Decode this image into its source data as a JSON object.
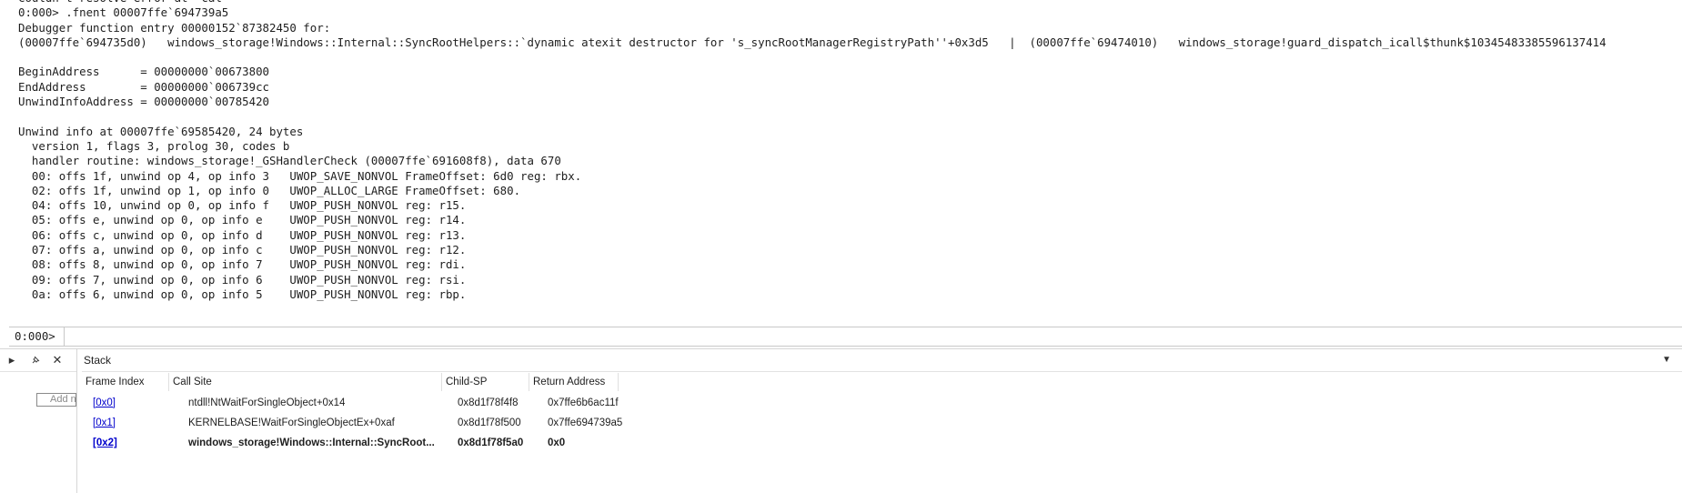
{
  "console": {
    "lines": [
      "Couldn't resolve error at 'cal",
      "0:000> .fnent 00007ffe`694739a5",
      "Debugger function entry 00000152`87382450 for:",
      "(00007ffe`694735d0)   windows_storage!Windows::Internal::SyncRootHelpers::`dynamic atexit destructor for 's_syncRootManagerRegistryPath''+0x3d5   |  (00007ffe`69474010)   windows_storage!guard_dispatch_icall$thunk$10345483385596137414",
      "",
      "BeginAddress      = 00000000`00673800",
      "EndAddress        = 00000000`006739cc",
      "UnwindInfoAddress = 00000000`00785420",
      "",
      "Unwind info at 00007ffe`69585420, 24 bytes",
      "  version 1, flags 3, prolog 30, codes b",
      "  handler routine: windows_storage!_GSHandlerCheck (00007ffe`691608f8), data 670",
      "  00: offs 1f, unwind op 4, op info 3   UWOP_SAVE_NONVOL FrameOffset: 6d0 reg: rbx.",
      "  02: offs 1f, unwind op 1, op info 0   UWOP_ALLOC_LARGE FrameOffset: 680.",
      "  04: offs 10, unwind op 0, op info f   UWOP_PUSH_NONVOL reg: r15.",
      "  05: offs e, unwind op 0, op info e    UWOP_PUSH_NONVOL reg: r14.",
      "  06: offs c, unwind op 0, op info d    UWOP_PUSH_NONVOL reg: r13.",
      "  07: offs a, unwind op 0, op info c    UWOP_PUSH_NONVOL reg: r12.",
      "  08: offs 8, unwind op 0, op info 7    UWOP_PUSH_NONVOL reg: rdi.",
      "  09: offs 7, unwind op 0, op info 6    UWOP_PUSH_NONVOL reg: rsi.",
      "  0a: offs 6, unwind op 0, op info 5    UWOP_PUSH_NONVOL reg: rbp."
    ]
  },
  "command": {
    "prompt": "0:000>",
    "value": ""
  },
  "leftpane": {
    "add_placeholder": "Add n",
    "pin_icon": "pin-icon",
    "close_icon": "close-icon"
  },
  "stack": {
    "title": "Stack",
    "dropdown_icon": "chevron-down-icon",
    "columns": {
      "frame_index": "Frame Index",
      "call_site": "Call Site",
      "child_sp": "Child-SP",
      "return_address": "Return Address"
    },
    "rows": [
      {
        "frame": "[0x0]",
        "call_site": "ntdll!NtWaitForSingleObject+0x14",
        "child_sp": "0x8d1f78f4f8",
        "ret": "0x7ffe6b6ac11f",
        "bold": false
      },
      {
        "frame": "[0x1]",
        "call_site": "KERNELBASE!WaitForSingleObjectEx+0xaf",
        "child_sp": "0x8d1f78f500",
        "ret": "0x7ffe694739a5",
        "bold": false
      },
      {
        "frame": "[0x2]",
        "call_site": "windows_storage!Windows::Internal::SyncRoot...",
        "child_sp": "0x8d1f78f5a0",
        "ret": "0x0",
        "bold": true
      }
    ]
  }
}
